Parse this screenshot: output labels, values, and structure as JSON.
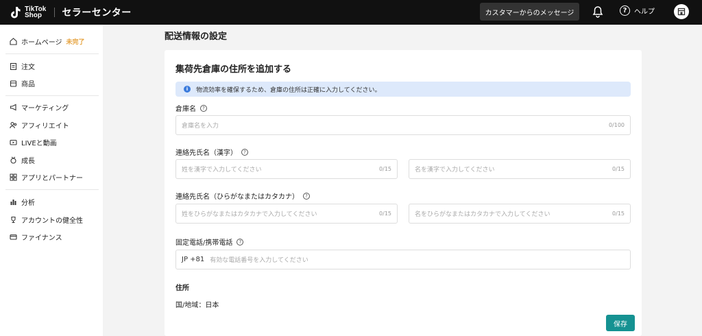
{
  "header": {
    "brand_line1": "TikTok",
    "brand_line2": "Shop",
    "app_title": "セラーセンター",
    "message_button": "カスタマーからのメッセージ",
    "help_label": "ヘルプ"
  },
  "sidebar": {
    "home": "ホームページ",
    "home_badge": "未完了",
    "items": [
      {
        "label": "注文",
        "icon": "order-icon"
      },
      {
        "label": "商品",
        "icon": "product-icon"
      },
      {
        "label": "マーケティング",
        "icon": "megaphone-icon"
      },
      {
        "label": "アフィリエイト",
        "icon": "affiliate-icon"
      },
      {
        "label": "LIVEと動画",
        "icon": "live-video-icon"
      },
      {
        "label": "成長",
        "icon": "growth-icon"
      },
      {
        "label": "アプリとパートナー",
        "icon": "apps-icon"
      },
      {
        "label": "分析",
        "icon": "analytics-icon"
      },
      {
        "label": "アカウントの健全性",
        "icon": "trophy-icon"
      },
      {
        "label": "ファイナンス",
        "icon": "card-icon"
      }
    ]
  },
  "page": {
    "title": "配送情報の設定",
    "card_title": "集荷先倉庫の住所を追加する",
    "info_text": "物流効率を確保するため、倉庫の住所は正確に入力してください。",
    "warehouse_label": "倉庫名",
    "warehouse_placeholder": "倉庫名を入力",
    "warehouse_count": "0/100",
    "kanji_label": "連絡先氏名（漢字）",
    "kanji_last_placeholder": "姓を漢字で入力してください",
    "kanji_first_placeholder": "名を漢字で入力してください",
    "kanji_count": "0/15",
    "kana_label": "連絡先氏名（ひらがなまたはカタカナ）",
    "kana_last_placeholder": "姓をひらがなまたはカタカナで入力してください",
    "kana_first_placeholder": "名をひらがなまたはカタカナで入力してください",
    "kana_count": "0/15",
    "phone_label": "固定電話/携帯電話",
    "phone_prefix": "JP +81",
    "phone_placeholder": "有効な電話番号を入力してください",
    "address_heading": "住所",
    "country_line": "国/地域：日本",
    "save_button": "保存"
  }
}
